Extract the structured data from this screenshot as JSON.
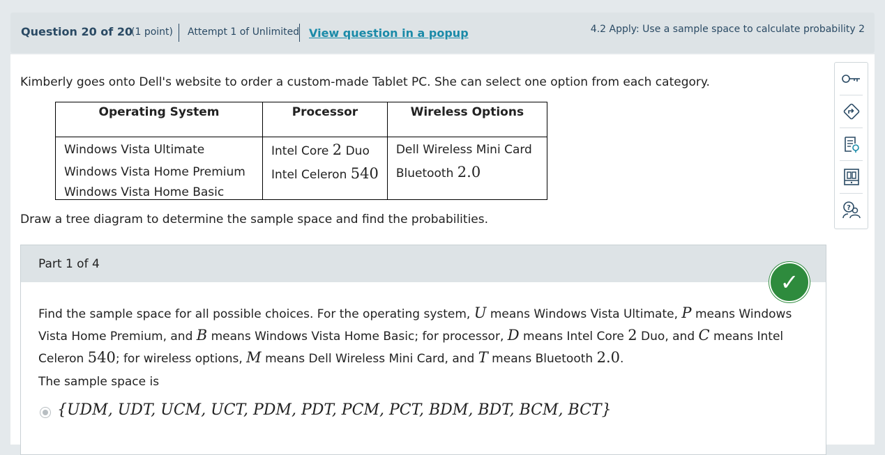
{
  "header": {
    "question_label": "Question 20 of 20",
    "points": "(1 point)",
    "attempt": "Attempt 1 of Unlimited",
    "popup_link": "View question in a popup",
    "topic": "4.2 Apply: Use a sample space to calculate probability 2"
  },
  "question": {
    "intro": "Kimberly goes onto Dell's website to order a custom-made Tablet PC. She can select one option from each category.",
    "table": {
      "headers": [
        "Operating System",
        "Processor",
        "Wireless Options"
      ],
      "os": [
        "Windows Vista Ultimate",
        "Windows Vista Home Premium",
        "Windows Vista Home Basic"
      ],
      "processor": [
        {
          "pre": "Intel Core ",
          "num": "2",
          "post": " Duo"
        },
        {
          "pre": "Intel Celeron ",
          "num": "540",
          "post": ""
        }
      ],
      "wireless": [
        {
          "pre": "Dell Wireless Mini Card",
          "num": "",
          "post": ""
        },
        {
          "pre": "Bluetooth ",
          "num": "2.0",
          "post": ""
        }
      ]
    },
    "instruction": "Draw a tree diagram to determine the sample space and find the probabilities."
  },
  "part": {
    "title": "Part 1 of 4",
    "status": "correct",
    "description": {
      "t1": "Find the sample space for all possible choices. For the operating system, ",
      "v1": "U",
      "t2": " means Windows Vista Ultimate, ",
      "v2": "P",
      "t3": " means Windows Vista Home Premium, and ",
      "v3": "B",
      "t4": " means Windows Vista Home Basic; for processor, ",
      "v4": "D",
      "t5": " means Intel Core ",
      "n1": "2",
      "t6": " Duo, and ",
      "v5": "C",
      "t7": " means Intel Celeron ",
      "n2": "540",
      "t8": "; for wireless options, ",
      "v6": "M",
      "t9": " means Dell Wireless Mini Card, and ",
      "v7": "T",
      "t10": " means Bluetooth ",
      "n3": "2.0",
      "t11": "."
    },
    "sample_space_label": "The sample space is",
    "answer": "{UDM, UDT, UCM, UCT, PDM, PDT, PCM, PCT, BDM, BDT, BCM, BCT}"
  },
  "tools": [
    "key-icon",
    "hint-icon",
    "notes-icon",
    "textbook-icon",
    "help-icon"
  ]
}
